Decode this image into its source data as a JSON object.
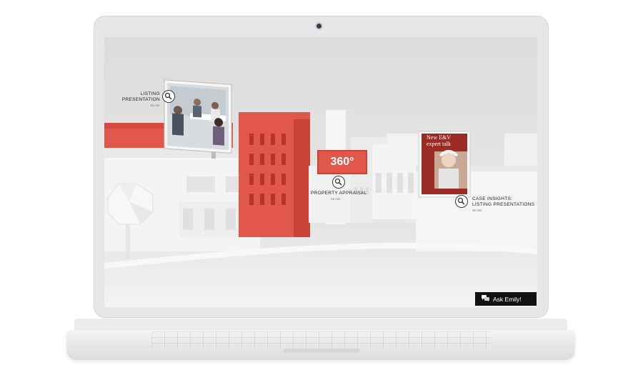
{
  "hotspots": {
    "listing": {
      "line1": "LISTING",
      "line2": "PRESENTATION",
      "duration": "15 min"
    },
    "appraisal": {
      "label": "PROPERTY APPRAISAL",
      "duration": "15 min"
    },
    "insights": {
      "line1": "CASE INSIGHTS:",
      "line2": "LISTING PRESENTATIONS",
      "duration": "30 min"
    }
  },
  "badge360": "360°",
  "billboard_right": {
    "title_line1": "New E&V",
    "title_line2": "expert talk"
  },
  "ask_button": {
    "label": "Ask Emily!"
  },
  "colors": {
    "accent": "#e2574c",
    "ink": "#111111",
    "building": "#f5f5f5"
  }
}
